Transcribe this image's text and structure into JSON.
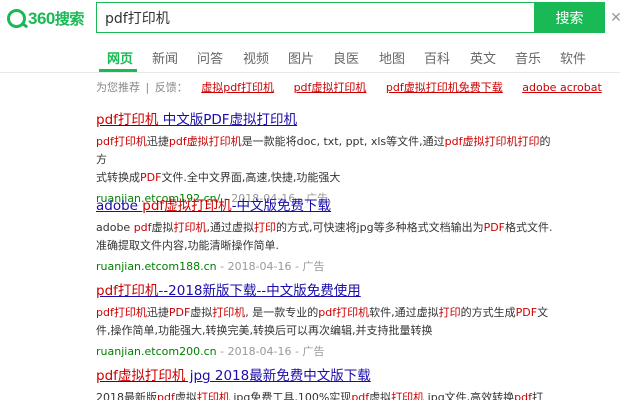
{
  "brand": {
    "logo_num": "360",
    "logo_text": "搜索"
  },
  "search": {
    "query": "pdf打印机",
    "button": "搜索"
  },
  "tabs": [
    {
      "label": "网页",
      "active": true
    },
    {
      "label": "新闻"
    },
    {
      "label": "问答"
    },
    {
      "label": "视频"
    },
    {
      "label": "图片"
    },
    {
      "label": "良医"
    },
    {
      "label": "地图"
    },
    {
      "label": "百科"
    },
    {
      "label": "英文"
    },
    {
      "label": "音乐"
    },
    {
      "label": "软件"
    }
  ],
  "suggest": {
    "prefix": "为您推荐",
    "sep": "|",
    "feedback": "反馈：",
    "links": [
      "虚拟pdf打印机",
      "pdf虚拟打印机",
      "pdf虚拟打印机免费下载",
      "adobe acrobat"
    ]
  },
  "results": [
    {
      "title_parts": [
        "pdf打印机",
        " 中文版PDF虚拟打印机"
      ],
      "desc_line1": [
        "pdf打印机",
        "迅捷",
        "pdf虚拟打印机",
        "是一款能将doc, txt, ppt, xls等文件,通过",
        "pdf虚拟打印机打印",
        "的方"
      ],
      "desc_line2": [
        "式转换成",
        "PDF",
        "文件.全中文界面,高速,快捷,功能强大"
      ],
      "url": "ruanjian.etcom192.cn/",
      "date": " - 2018-04-16",
      "ad": " - 广告"
    },
    {
      "title_parts": [
        "adobe ",
        "pdf虚拟打印机",
        "-中文版免费下载"
      ],
      "desc_line1": [
        "adobe ",
        "pdf",
        "虚拟",
        "打印机",
        ",通过虚拟",
        "打印",
        "的方式,可快速将jpg等多种格式文档输出为",
        "PDF",
        "格式文件."
      ],
      "desc_line2": [
        "准确提取文件内容,功能清晰操作简单."
      ],
      "url": "ruanjian.etcom188.cn",
      "date": " - 2018-04-16",
      "ad": " - 广告"
    },
    {
      "title_parts": [
        "pdf打印机",
        "--2018新版下载--中文版免费使用"
      ],
      "desc_line1": [
        "pdf打印机",
        "迅捷",
        "PDF",
        "虚拟",
        "打印机",
        ", 是一款专业的",
        "pdf打印机",
        "软件,通过虚拟",
        "打印",
        "的方式生成",
        "PDF",
        "文"
      ],
      "desc_line2": [
        "件,操作简单,功能强大,转换完美,转换后可以再次编辑,并支持批量转换"
      ],
      "url": "ruanjian.etcom200.cn",
      "date": " - 2018-04-16",
      "ad": " - 广告"
    },
    {
      "title_parts": [
        "pdf虚拟打印机",
        " jpg 2018最新免费中文版下载"
      ],
      "desc_line1": [
        "2018最新版",
        "pdf",
        "虚拟",
        "打印机",
        " jpg免费工具,100%实现",
        "pdf",
        "虚拟",
        "打印机",
        " jpg文件,高效转换",
        "pdf",
        "打"
      ],
      "desc_line2": [],
      "url": "",
      "date": "",
      "ad": ""
    }
  ],
  "colors": {
    "brand_green": "#19b955",
    "link_blue": "#1a0dab",
    "highlight_red": "#cc0000",
    "url_green": "#008000"
  },
  "icons": {
    "clear": "close-icon",
    "logo": "magnifier-logo-icon"
  }
}
